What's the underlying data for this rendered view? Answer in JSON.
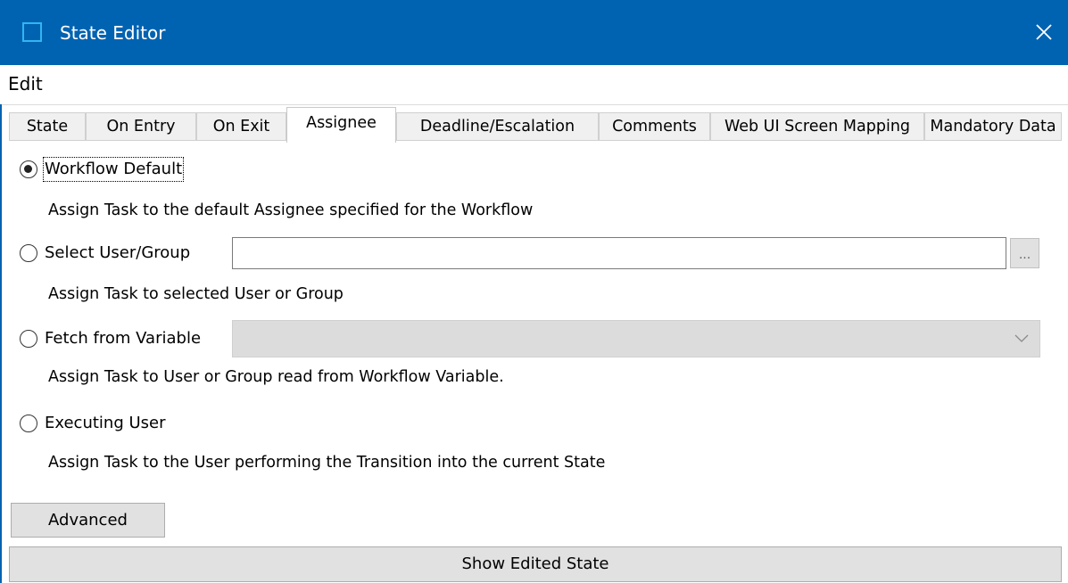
{
  "window": {
    "title": "State Editor",
    "titlebar_color": "#0063b1"
  },
  "menu": {
    "edit_label": "Edit"
  },
  "tabs": [
    {
      "label": "State"
    },
    {
      "label": "On Entry"
    },
    {
      "label": "On Exit"
    },
    {
      "label": "Assignee",
      "active": true
    },
    {
      "label": "Deadline/Escalation"
    },
    {
      "label": "Comments"
    },
    {
      "label": "Web UI Screen Mapping"
    },
    {
      "label": "Mandatory Data"
    }
  ],
  "assignee": {
    "options": [
      {
        "label": "Workflow Default",
        "description": "Assign Task to the default Assignee specified for the Workflow",
        "checked": true
      },
      {
        "label": "Select User/Group",
        "description": "Assign Task to selected User or Group",
        "checked": false
      },
      {
        "label": "Fetch from Variable",
        "description": "Assign Task to User or Group read from Workflow Variable.",
        "checked": false
      },
      {
        "label": "Executing User",
        "description": "Assign Task to the User performing the Transition into the current State",
        "checked": false
      }
    ],
    "user_group_value": "",
    "browse_label": "...",
    "variable_value": ""
  },
  "buttons": {
    "advanced_label": "Advanced",
    "show_edited_state_label": "Show Edited State"
  }
}
